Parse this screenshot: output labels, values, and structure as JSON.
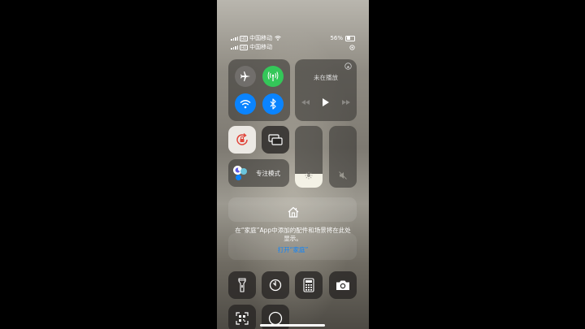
{
  "status": {
    "line1": {
      "sim": "HD",
      "carrier": "中国移动",
      "battery_text": "56%",
      "battery_level": 0.56
    },
    "line2": {
      "sim": "HD",
      "carrier": "中国移动"
    }
  },
  "connectivity": {
    "airplane": {
      "icon": "airplane-icon",
      "active": false
    },
    "cellular": {
      "icon": "cellular-antenna-icon",
      "active": true,
      "color": "#34c759"
    },
    "wifi": {
      "icon": "wifi-icon",
      "active": true,
      "color": "#0a84ff"
    },
    "bluetooth": {
      "icon": "bluetooth-icon",
      "active": true,
      "color": "#0a84ff"
    }
  },
  "media": {
    "title": "未在播放",
    "airplay_icon": "airplay-icon"
  },
  "controls": {
    "rotation_lock_icon": "rotation-lock-icon",
    "screen_mirror_icon": "screen-mirroring-icon",
    "focus_label": "专注模式",
    "brightness_level": 0.22,
    "volume_level": 0.0
  },
  "home": {
    "message": "在“家庭”App中添加的配件和场景将在此处显示。",
    "link": "打开“家庭”"
  },
  "bottom_buttons": [
    "flashlight-icon",
    "timer-icon",
    "calculator-icon",
    "camera-icon",
    "qr-scanner-icon",
    "record-icon"
  ],
  "colors": {
    "accent_blue": "#0a84ff",
    "accent_green": "#34c759",
    "rotation_red": "#e0453a"
  }
}
